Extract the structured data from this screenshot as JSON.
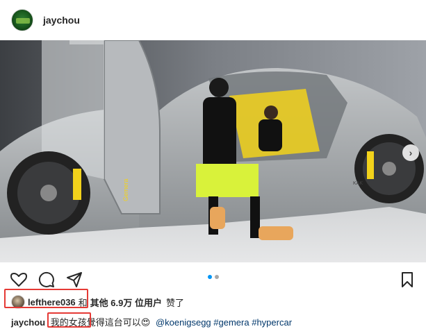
{
  "post": {
    "username": "jaychou"
  },
  "photo": {
    "car_model_text": "Gemera",
    "badge_text": "KAK"
  },
  "carousel": {
    "total": 2,
    "active": 1
  },
  "likes": {
    "liker": "lefthere036",
    "joiner": "和",
    "others_label": "其他 6.9万 位用户",
    "suffix": "赞了"
  },
  "caption": {
    "username": "jaychou",
    "text_highlighted": "我的女孩",
    "text_rest": "覺得這台可以😍",
    "mention": "@koenigsegg",
    "tag1": "#gemera",
    "tag2": "#hypercar"
  },
  "colors": {
    "accent_blue": "#0095f6",
    "highlight_red": "#e53935",
    "car_body": "#a9adb0",
    "brake_yellow": "#f2d21b"
  }
}
